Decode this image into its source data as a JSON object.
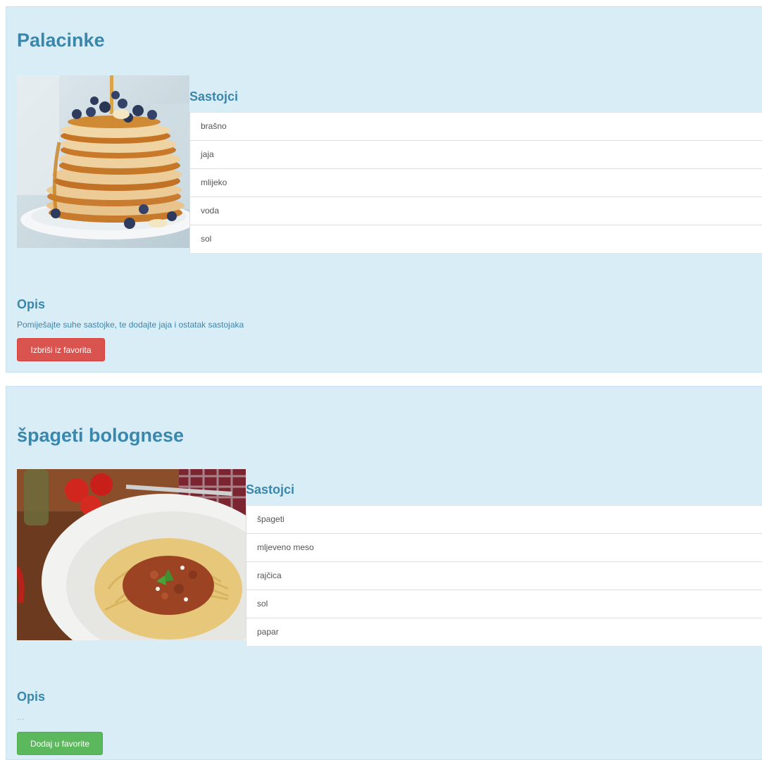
{
  "recipes": [
    {
      "title": "Palacinke",
      "ingredients_heading": "Sastojci",
      "ingredients": [
        "brašno",
        "jaja",
        "mlijeko",
        "voda",
        "sol"
      ],
      "description_heading": "Opis",
      "description": "Pomiješajte suhe sastojke, te dodajte jaja i ostatak sastojaka",
      "button_label": "Izbriši iz favorita",
      "button_color": "#d9534f",
      "image_subject": "stack of pancakes with blueberries and syrup"
    },
    {
      "title": "špageti bolognese",
      "ingredients_heading": "Sastojci",
      "ingredients": [
        "špageti",
        "mljeveno meso",
        "rajčica",
        "sol",
        "papar"
      ],
      "description_heading": "Opis",
      "description": "...",
      "button_label": "Dodaj u favorite",
      "button_color": "#5cb85c",
      "image_subject": "plate of spaghetti bolognese with tomatoes"
    }
  ],
  "colors": {
    "panel_background": "#d9edf7",
    "heading_text": "#3a87ad",
    "list_background": "#ffffff"
  }
}
